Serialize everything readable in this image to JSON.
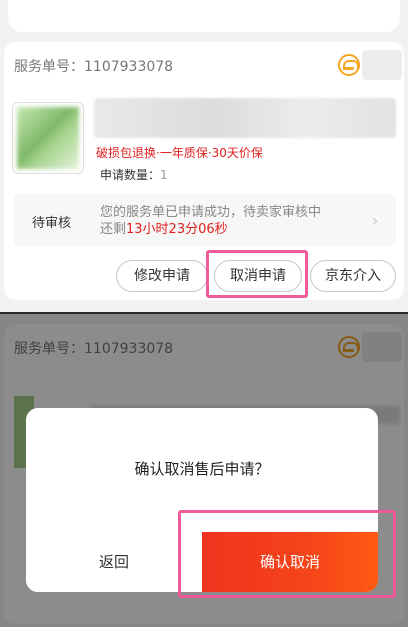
{
  "order": {
    "service_no": "服务单号：1107933078",
    "tags": "破损包退换·一年质保·30天价保",
    "qty_label": "申请数量：",
    "qty_value": "1"
  },
  "status": {
    "label": "待审核",
    "message_line1": "您的服务单已申请成功，待卖家审核中",
    "message_prefix": "还剩",
    "countdown": "13小时23分06秒"
  },
  "actions": {
    "modify": "修改申请",
    "cancel": "取消申请",
    "jd_intervene": "京东介入"
  },
  "dialog": {
    "message": "确认取消售后申请？",
    "back": "返回",
    "confirm": "确认取消"
  },
  "colors": {
    "accent_red": "#e02020",
    "highlight_pink": "#ef5a99",
    "icon_orange": "#f5a623"
  },
  "icons": {
    "support": "customer-service-headset-icon",
    "chevron": "chevron-right-icon"
  }
}
